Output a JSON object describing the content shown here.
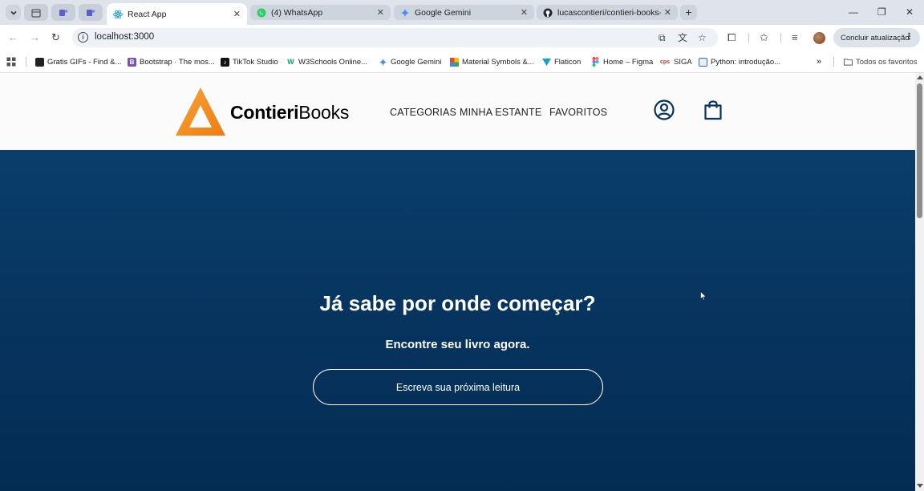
{
  "browser": {
    "tabs": [
      {
        "title": "React App",
        "icon": "react-icon",
        "active": true
      },
      {
        "title": "(4) WhatsApp",
        "icon": "whatsapp-icon",
        "active": false
      },
      {
        "title": "Google Gemini",
        "icon": "gemini-icon",
        "active": false
      },
      {
        "title": "lucascontieri/contieri-books-al",
        "icon": "github-icon",
        "active": false
      }
    ],
    "new_tab_label": "+",
    "url": "localhost:3000",
    "update_button_label": "Concluir atualização",
    "bookmarks": [
      {
        "label": "Gratis GIFs - Find &...",
        "icon": "gif-icon",
        "color": "#222222"
      },
      {
        "label": "Bootstrap · The mos...",
        "icon": "bootstrap-icon",
        "color": "#7952b3"
      },
      {
        "label": "TikTok Studio",
        "icon": "tiktok-icon",
        "color": "#111111"
      },
      {
        "label": "W3Schools Online...",
        "icon": "w3schools-icon",
        "color": "#04aa6d"
      },
      {
        "label": "Google Gemini",
        "icon": "gemini-icon",
        "color": "#4285f4"
      },
      {
        "label": "Material Symbols &...",
        "icon": "material-icon",
        "color": "#ea4335"
      },
      {
        "label": "Flaticon",
        "icon": "flaticon-icon",
        "color": "#17a2c6"
      },
      {
        "label": "Home – Figma",
        "icon": "figma-icon",
        "color": "#f24e1e"
      },
      {
        "label": "SIGA",
        "icon": "siga-icon",
        "color": "#c0392b"
      },
      {
        "label": "Python: introdução...",
        "icon": "python-icon",
        "color": "#3a6ea5"
      }
    ],
    "bookmarks_overflow": "»",
    "all_bookmarks_label": "Todos os favoritos"
  },
  "site": {
    "brand_bold": "Contieri",
    "brand_regular": "Books",
    "nav": [
      "CATEGORIAS",
      "MINHA ESTANTE",
      "FAVORITOS"
    ],
    "hero_title": "Já sabe por onde começar?",
    "hero_subtitle": "Encontre seu livro agora.",
    "search_placeholder": "Escreva sua próxima leitura"
  },
  "colors": {
    "accent_orange": "#f7941d",
    "hero_blue": "#073560",
    "tab_strip": "#dfe3eb"
  }
}
